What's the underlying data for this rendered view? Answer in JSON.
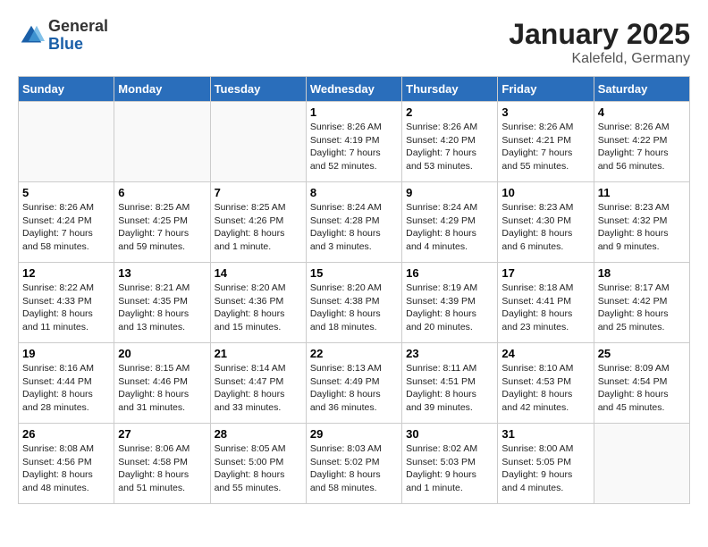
{
  "header": {
    "logo_general": "General",
    "logo_blue": "Blue",
    "main_title": "January 2025",
    "subtitle": "Kalefeld, Germany"
  },
  "calendar": {
    "days_of_week": [
      "Sunday",
      "Monday",
      "Tuesday",
      "Wednesday",
      "Thursday",
      "Friday",
      "Saturday"
    ],
    "weeks": [
      [
        {
          "day": "",
          "info": ""
        },
        {
          "day": "",
          "info": ""
        },
        {
          "day": "",
          "info": ""
        },
        {
          "day": "1",
          "info": "Sunrise: 8:26 AM\nSunset: 4:19 PM\nDaylight: 7 hours and 52 minutes."
        },
        {
          "day": "2",
          "info": "Sunrise: 8:26 AM\nSunset: 4:20 PM\nDaylight: 7 hours and 53 minutes."
        },
        {
          "day": "3",
          "info": "Sunrise: 8:26 AM\nSunset: 4:21 PM\nDaylight: 7 hours and 55 minutes."
        },
        {
          "day": "4",
          "info": "Sunrise: 8:26 AM\nSunset: 4:22 PM\nDaylight: 7 hours and 56 minutes."
        }
      ],
      [
        {
          "day": "5",
          "info": "Sunrise: 8:26 AM\nSunset: 4:24 PM\nDaylight: 7 hours and 58 minutes."
        },
        {
          "day": "6",
          "info": "Sunrise: 8:25 AM\nSunset: 4:25 PM\nDaylight: 7 hours and 59 minutes."
        },
        {
          "day": "7",
          "info": "Sunrise: 8:25 AM\nSunset: 4:26 PM\nDaylight: 8 hours and 1 minute."
        },
        {
          "day": "8",
          "info": "Sunrise: 8:24 AM\nSunset: 4:28 PM\nDaylight: 8 hours and 3 minutes."
        },
        {
          "day": "9",
          "info": "Sunrise: 8:24 AM\nSunset: 4:29 PM\nDaylight: 8 hours and 4 minutes."
        },
        {
          "day": "10",
          "info": "Sunrise: 8:23 AM\nSunset: 4:30 PM\nDaylight: 8 hours and 6 minutes."
        },
        {
          "day": "11",
          "info": "Sunrise: 8:23 AM\nSunset: 4:32 PM\nDaylight: 8 hours and 9 minutes."
        }
      ],
      [
        {
          "day": "12",
          "info": "Sunrise: 8:22 AM\nSunset: 4:33 PM\nDaylight: 8 hours and 11 minutes."
        },
        {
          "day": "13",
          "info": "Sunrise: 8:21 AM\nSunset: 4:35 PM\nDaylight: 8 hours and 13 minutes."
        },
        {
          "day": "14",
          "info": "Sunrise: 8:20 AM\nSunset: 4:36 PM\nDaylight: 8 hours and 15 minutes."
        },
        {
          "day": "15",
          "info": "Sunrise: 8:20 AM\nSunset: 4:38 PM\nDaylight: 8 hours and 18 minutes."
        },
        {
          "day": "16",
          "info": "Sunrise: 8:19 AM\nSunset: 4:39 PM\nDaylight: 8 hours and 20 minutes."
        },
        {
          "day": "17",
          "info": "Sunrise: 8:18 AM\nSunset: 4:41 PM\nDaylight: 8 hours and 23 minutes."
        },
        {
          "day": "18",
          "info": "Sunrise: 8:17 AM\nSunset: 4:42 PM\nDaylight: 8 hours and 25 minutes."
        }
      ],
      [
        {
          "day": "19",
          "info": "Sunrise: 8:16 AM\nSunset: 4:44 PM\nDaylight: 8 hours and 28 minutes."
        },
        {
          "day": "20",
          "info": "Sunrise: 8:15 AM\nSunset: 4:46 PM\nDaylight: 8 hours and 31 minutes."
        },
        {
          "day": "21",
          "info": "Sunrise: 8:14 AM\nSunset: 4:47 PM\nDaylight: 8 hours and 33 minutes."
        },
        {
          "day": "22",
          "info": "Sunrise: 8:13 AM\nSunset: 4:49 PM\nDaylight: 8 hours and 36 minutes."
        },
        {
          "day": "23",
          "info": "Sunrise: 8:11 AM\nSunset: 4:51 PM\nDaylight: 8 hours and 39 minutes."
        },
        {
          "day": "24",
          "info": "Sunrise: 8:10 AM\nSunset: 4:53 PM\nDaylight: 8 hours and 42 minutes."
        },
        {
          "day": "25",
          "info": "Sunrise: 8:09 AM\nSunset: 4:54 PM\nDaylight: 8 hours and 45 minutes."
        }
      ],
      [
        {
          "day": "26",
          "info": "Sunrise: 8:08 AM\nSunset: 4:56 PM\nDaylight: 8 hours and 48 minutes."
        },
        {
          "day": "27",
          "info": "Sunrise: 8:06 AM\nSunset: 4:58 PM\nDaylight: 8 hours and 51 minutes."
        },
        {
          "day": "28",
          "info": "Sunrise: 8:05 AM\nSunset: 5:00 PM\nDaylight: 8 hours and 55 minutes."
        },
        {
          "day": "29",
          "info": "Sunrise: 8:03 AM\nSunset: 5:02 PM\nDaylight: 8 hours and 58 minutes."
        },
        {
          "day": "30",
          "info": "Sunrise: 8:02 AM\nSunset: 5:03 PM\nDaylight: 9 hours and 1 minute."
        },
        {
          "day": "31",
          "info": "Sunrise: 8:00 AM\nSunset: 5:05 PM\nDaylight: 9 hours and 4 minutes."
        },
        {
          "day": "",
          "info": ""
        }
      ]
    ]
  }
}
